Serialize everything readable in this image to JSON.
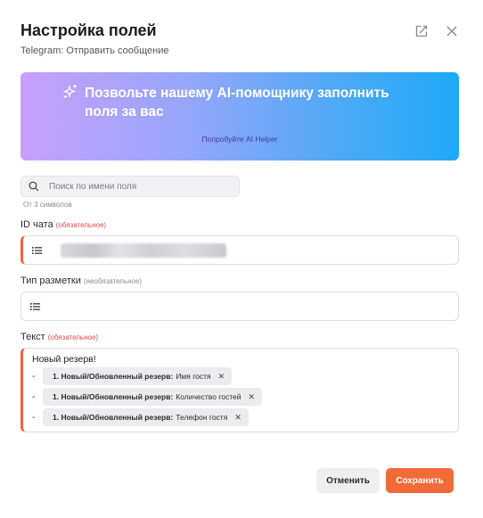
{
  "header": {
    "title": "Настройка полей",
    "subtitle": "Telegram: Отправить сообщение"
  },
  "banner": {
    "headline": "Позвольте нашему AI-помощнику заполнить поля за вас",
    "link": "Попробуйте AI Helper",
    "gradient": [
      "#c8a0fb",
      "#1da9f6"
    ]
  },
  "search": {
    "placeholder": "Поиск по имени поля",
    "hint": "От 3 символов"
  },
  "fields": {
    "chat_id": {
      "label": "ID чата",
      "badge": "(обязательное)"
    },
    "markup": {
      "label": "Тип разметки",
      "badge": "(необязательное)"
    },
    "text": {
      "label": "Текст",
      "badge": "(обязательное)",
      "first_line": "Новый резерв!",
      "rows": [
        {
          "dash": "-",
          "source": "1. Новый/Обновленный резерв:",
          "field": "Имя гостя"
        },
        {
          "dash": "-",
          "source": "1. Новый/Обновленный резерв:",
          "field": "Количество гостей"
        },
        {
          "dash": "-",
          "source": "1. Новый/Обновленный резерв:",
          "field": "Телефон гостя"
        }
      ]
    }
  },
  "footer": {
    "cancel_label": "Отменить",
    "save_label": "Сохранить"
  },
  "colors": {
    "accent": "#f26a38",
    "required": "#e5484d",
    "required_bar": "#f0643c"
  },
  "icons": {
    "header": [
      "expand-icon",
      "close-icon"
    ],
    "banner": "sparkle-icon",
    "search": "search-icon",
    "field": "list-icon",
    "chip_remove": "remove-icon"
  }
}
